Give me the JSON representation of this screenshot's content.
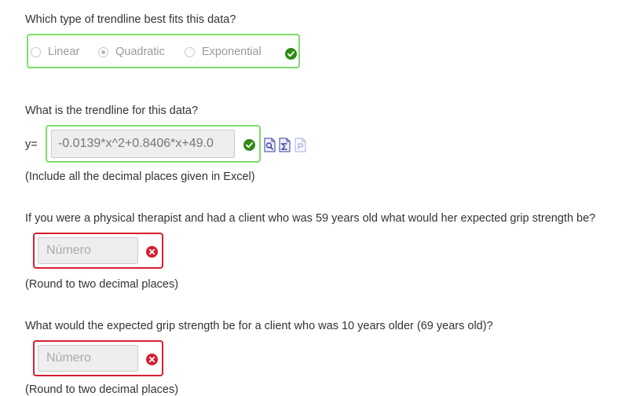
{
  "q1": {
    "question": "Which type of trendline best fits this data?",
    "options": [
      "Linear",
      "Quadratic",
      "Exponential"
    ],
    "selected": "Quadratic",
    "status": "correct"
  },
  "q2": {
    "question": "What is the trendline for this data?",
    "prefix": "y=",
    "value": "-0.0139*x^2+0.8406*x+49.0",
    "status": "correct",
    "hint": "(Include all the decimal places given in Excel)",
    "tool_icons": [
      "preview-icon",
      "equation-icon",
      "help-icon"
    ]
  },
  "q3": {
    "question": "If you were a physical therapist and had a client who was 59 years old what would her expected grip strength be?",
    "placeholder": "Número",
    "status": "incorrect",
    "hint": "(Round to two decimal places)"
  },
  "q4": {
    "question": "What would the expected grip strength be for a client who was 10 years older (69 years old)?",
    "placeholder": "Número",
    "status": "incorrect",
    "hint": "(Round to two decimal places)"
  },
  "colors": {
    "correct": "#2e8b17",
    "correct_border": "#7ddc6b",
    "incorrect": "#d4202f",
    "incorrect_border": "#d4202f"
  }
}
